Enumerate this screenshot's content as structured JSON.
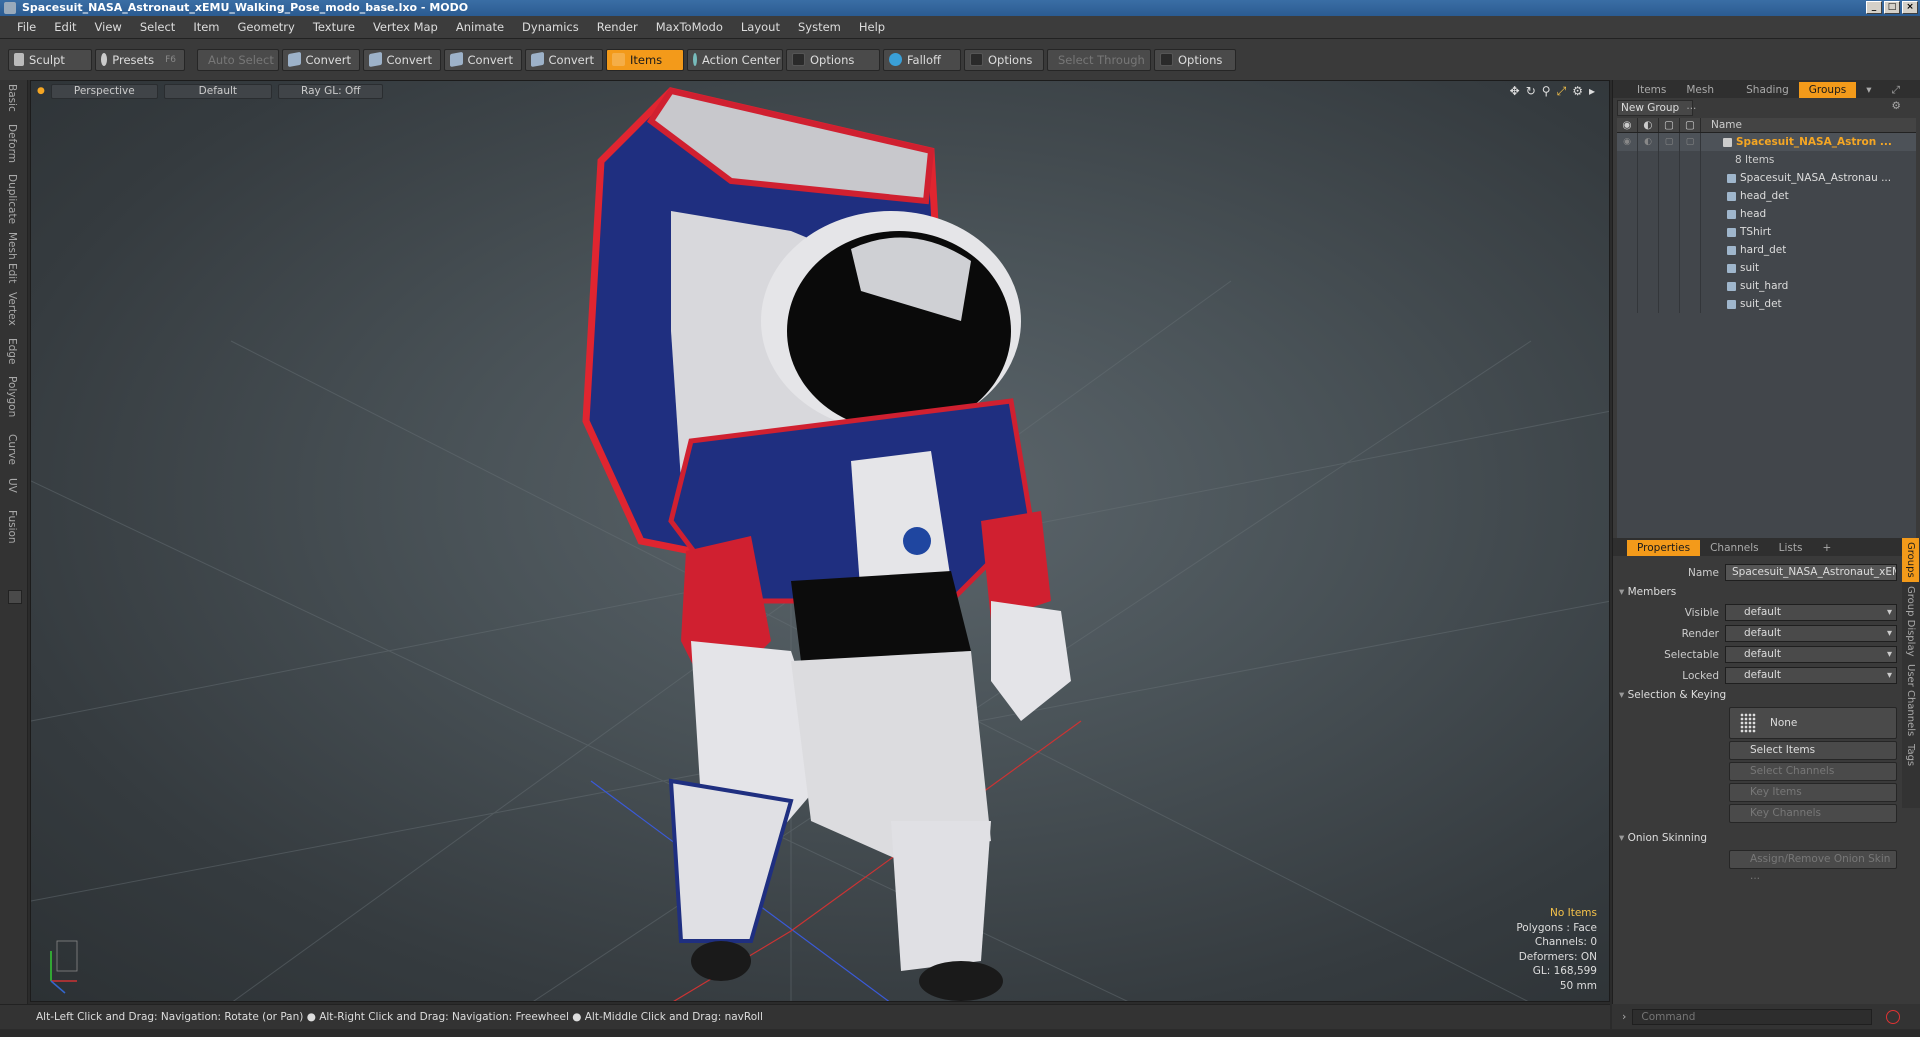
{
  "window": {
    "title": "Spacesuit_NASA_Astronaut_xEMU_Walking_Pose_modo_base.lxo - MODO",
    "controls": [
      "_",
      "□",
      "×"
    ]
  },
  "menu": [
    "File",
    "Edit",
    "View",
    "Select",
    "Item",
    "Geometry",
    "Texture",
    "Vertex Map",
    "Animate",
    "Dynamics",
    "Render",
    "MaxToModo",
    "Layout",
    "System",
    "Help"
  ],
  "toolbar": {
    "sculpt": "Sculpt",
    "presets": "Presets",
    "presets_key": "F6",
    "auto_select": "Auto Select",
    "convert1": "Convert",
    "convert2": "Convert",
    "convert3": "Convert",
    "convert4": "Convert",
    "items": "Items",
    "action_center": "Action Center",
    "options1": "Options",
    "falloff": "Falloff",
    "options2": "Options",
    "select_through": "Select Through",
    "options3": "Options"
  },
  "left_tabs": [
    "Basic",
    "Deform",
    "Duplicate",
    "Mesh Edit",
    "Vertex",
    "Edge",
    "Polygon",
    "Curve",
    "UV",
    "Fusion"
  ],
  "viewport": {
    "perspective": "Perspective",
    "shading": "Default",
    "raygl": "Ray GL: Off",
    "info": {
      "items": "No Items",
      "polygons": "Polygons : Face",
      "channels": "Channels: 0",
      "deformers": "Deformers: ON",
      "gl": "GL: 168,599",
      "focal": "50 mm"
    }
  },
  "status_text": "Alt-Left Click and Drag: Navigation: Rotate (or Pan) ● Alt-Right Click and Drag: Navigation: Freewheel ● Alt-Middle Click and Drag: navRoll",
  "outliner": {
    "tabs": [
      "Items",
      "Mesh ...",
      "Shading",
      "Groups"
    ],
    "active_tab": "Groups",
    "new_group": "New Group",
    "name_header": "Name",
    "group_name": "Spacesuit_NASA_Astron ...",
    "group_count": "8 Items",
    "children": [
      "Spacesuit_NASA_Astronau ...",
      "head_det",
      "head",
      "TShirt",
      "hard_det",
      "suit",
      "suit_hard",
      "suit_det"
    ]
  },
  "properties": {
    "tabs": [
      "Properties",
      "Channels",
      "Lists",
      "+"
    ],
    "name_label": "Name",
    "name_value": "Spacesuit_NASA_Astronaut_xEM",
    "members": "Members",
    "visible_label": "Visible",
    "visible_value": "default",
    "render_label": "Render",
    "render_value": "default",
    "selectable_label": "Selectable",
    "selectable_value": "default",
    "locked_label": "Locked",
    "locked_value": "default",
    "selection_keying": "Selection & Keying",
    "none": "None",
    "select_items": "Select Items",
    "select_channels": "Select Channels",
    "key_items": "Key Items",
    "key_channels": "Key Channels",
    "onion": "Onion Skinning",
    "onion_btn": "Assign/Remove Onion Skin ..."
  },
  "side_tabs": [
    "Groups",
    "Group Display",
    "User Channels",
    "Tags"
  ],
  "command": {
    "placeholder": "Command"
  },
  "colors": {
    "accent": "#f39a1a",
    "viewport": "#4a5358",
    "panel": "#3a3a3a"
  }
}
